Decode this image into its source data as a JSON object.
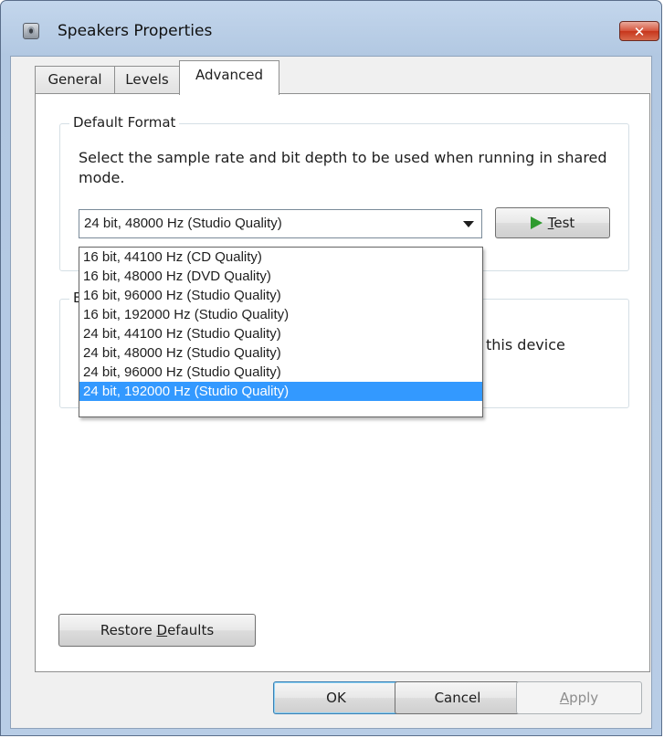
{
  "window": {
    "title": "Speakers Properties",
    "close_glyph": "✕"
  },
  "tabs": [
    {
      "label": "General"
    },
    {
      "label": "Levels"
    },
    {
      "label": "Advanced"
    }
  ],
  "default_format": {
    "group_label": "Default Format",
    "description": "Select the sample rate and bit depth to be used when running in shared mode.",
    "selected": "24 bit, 48000 Hz (Studio Quality)",
    "options": [
      "16 bit, 44100 Hz (CD Quality)",
      "16 bit, 48000 Hz (DVD Quality)",
      "16 bit, 96000 Hz (Studio Quality)",
      "16 bit, 192000 Hz (Studio Quality)",
      "24 bit, 44100 Hz (Studio Quality)",
      "24 bit, 48000 Hz (Studio Quality)",
      "24 bit, 96000 Hz (Studio Quality)",
      "24 bit, 192000 Hz (Studio Quality)"
    ],
    "highlighted_index": 7,
    "test_button": {
      "mnemonic": "T",
      "rest": "est"
    }
  },
  "exclusive_group": {
    "visible_label_fragment": "E",
    "visible_text_fragment": "this device"
  },
  "restore_button": {
    "before": "Restore ",
    "mnemonic": "D",
    "rest": "efaults"
  },
  "footer": {
    "ok_label": "OK",
    "cancel_label": "Cancel",
    "apply_mnemonic": "A",
    "apply_rest": "pply"
  },
  "colors": {
    "selection": "#3399ff",
    "play_icon": "#2f9a2f",
    "close_button": "#c7351b"
  },
  "icons": {
    "window_icon": "speaker-icon",
    "test_icon": "play-icon",
    "close_icon": "close-icon"
  }
}
